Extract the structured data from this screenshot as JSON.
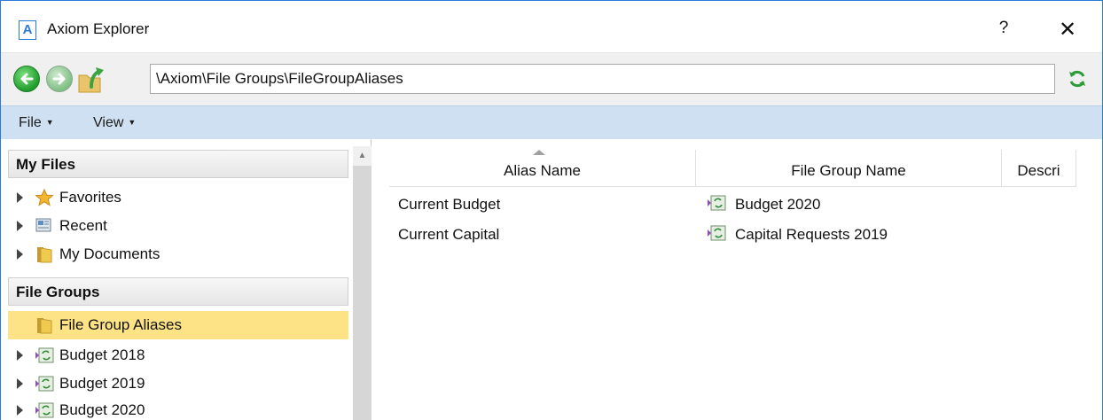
{
  "window": {
    "title": "Axiom Explorer",
    "app_icon_letter": "A",
    "help_label": "?",
    "close_label": "✕"
  },
  "address": {
    "path": "\\Axiom\\File Groups\\FileGroupAliases"
  },
  "menu": {
    "file_label": "File",
    "view_label": "View"
  },
  "sidebar": {
    "my_files_header": "My Files",
    "my_files_items": [
      {
        "label": "Favorites",
        "icon": "star-icon"
      },
      {
        "label": "Recent",
        "icon": "recent-icon"
      },
      {
        "label": "My Documents",
        "icon": "folder-icon"
      }
    ],
    "file_groups_header": "File Groups",
    "file_groups_items": [
      {
        "label": "File Group Aliases",
        "icon": "folder-icon",
        "selected": true
      },
      {
        "label": "Budget 2018",
        "icon": "file-group-icon"
      },
      {
        "label": "Budget 2019",
        "icon": "file-group-icon"
      },
      {
        "label": "Budget 2020",
        "icon": "file-group-icon"
      }
    ]
  },
  "table": {
    "columns": [
      "Alias Name",
      "File Group Name",
      "Descri"
    ],
    "rows": [
      {
        "alias": "Current Budget",
        "file_group": "Budget 2020"
      },
      {
        "alias": "Current Capital",
        "file_group": "Capital Requests 2019"
      }
    ]
  },
  "colors": {
    "accent": "#2b7bd6",
    "menubar": "#cfe0f2",
    "selected": "#fde385"
  }
}
